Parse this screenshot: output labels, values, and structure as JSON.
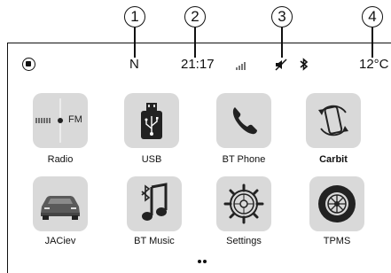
{
  "callouts": [
    "1",
    "2",
    "3",
    "4"
  ],
  "status": {
    "gear": "N",
    "time": "21:17",
    "signal_icon": "signal-bars",
    "mute_icon": "speaker-muted",
    "bluetooth_icon": "bluetooth",
    "temperature": "12°C"
  },
  "apps": [
    {
      "label": "Radio",
      "icon": "radio-fm"
    },
    {
      "label": "USB",
      "icon": "usb-stick"
    },
    {
      "label": "BT Phone",
      "icon": "phone"
    },
    {
      "label": "Carbit",
      "icon": "phone-rotate"
    },
    {
      "label": "JACiev",
      "icon": "car"
    },
    {
      "label": "BT Music",
      "icon": "bluetooth-music"
    },
    {
      "label": "Settings",
      "icon": "gear"
    },
    {
      "label": "TPMS",
      "icon": "tire"
    }
  ],
  "radio_fm": "FM",
  "colors": {
    "tile": "#d9d9d9",
    "icon_dark": "#222222"
  }
}
